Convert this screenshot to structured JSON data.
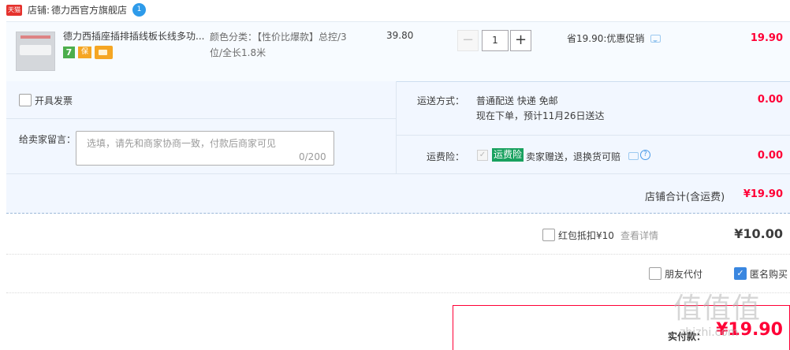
{
  "shop": {
    "badge": "天猫",
    "label": "店铺:",
    "name": "德力西官方旗舰店",
    "ww_badge": "1"
  },
  "item": {
    "title": "德力西插座插排插线板长线多功...",
    "sku": "颜色分类：【性价比爆款】总控/3位/全长1.8米",
    "unit_price": "39.80",
    "qty_minus": "−",
    "qty": "1",
    "qty_plus": "+",
    "promo": "省19.90:优惠促销",
    "subtotal": "19.90",
    "services": [
      "7",
      "保"
    ]
  },
  "options": {
    "invoice_label": "开具发票",
    "message_label": "给卖家留言：",
    "message_placeholder": "选填，请先和商家协商一致，付款后商家可见",
    "message_count": "0/200",
    "shipping_label": "运送方式：",
    "shipping_method": "普通配送 快递 免邮",
    "shipping_eta": "现在下单，预计11月26日送达",
    "shipping_fee": "0.00",
    "insurance_label": "运费险：",
    "insurance_check": "✓",
    "insurance_tag": "运费险",
    "insurance_desc": "卖家赠送，退换货可赔",
    "insurance_help": "?",
    "insurance_fee": "0.00",
    "shop_total_label": "店铺合计(含运费)",
    "shop_total": "¥19.90"
  },
  "coupon": {
    "label": "红包抵扣¥10",
    "link": "查看详情",
    "value": "¥10.00"
  },
  "extras": {
    "friend_pay": "朋友代付",
    "anonymous": "匿名购买",
    "anonymous_check": "✓"
  },
  "pay": {
    "label": "实付款：",
    "value": "¥19.90"
  },
  "watermark": {
    "text": "值值值",
    "sub": "zhizhi.com"
  }
}
